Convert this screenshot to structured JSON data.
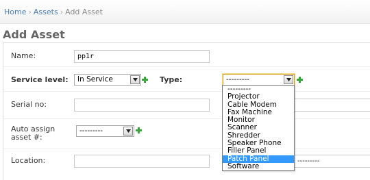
{
  "breadcrumb": {
    "home": "Home",
    "assets": "Assets",
    "current": "Add Asset",
    "separator": "›"
  },
  "page": {
    "title": "Add Asset"
  },
  "form": {
    "name": {
      "label": "Name:",
      "value": "pp1r"
    },
    "service_level": {
      "label": "Service level:",
      "value": "In Service"
    },
    "type": {
      "label": "Type:",
      "value": "---------",
      "options": [
        "---------",
        "Projector",
        "Cable Modem",
        "Fax Machine",
        "Monitor",
        "Scanner",
        "Shredder",
        "Speaker Phone",
        "Filler Panel",
        "Patch Panel",
        "Software"
      ],
      "highlighted": "Patch Panel"
    },
    "serial_no": {
      "label": "Serial no:",
      "value": ""
    },
    "auto_assign": {
      "label_line1": "Auto assign",
      "label_line2": "asset #:",
      "value": "---------"
    },
    "location": {
      "label": "Location:",
      "value": "",
      "secondary_value": "---------"
    }
  },
  "colors": {
    "link": "#4a7fb0",
    "add_icon": "#3aa53a",
    "highlight": "#3399ff",
    "focus_border": "#d4a017"
  }
}
